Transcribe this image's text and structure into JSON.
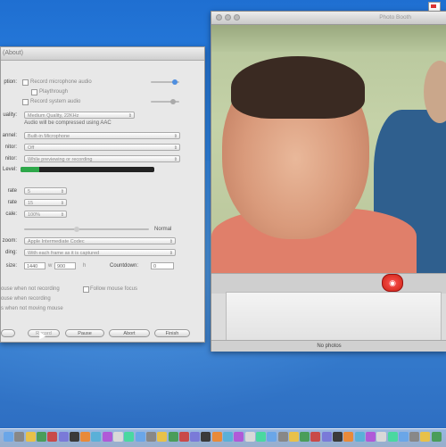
{
  "recorder": {
    "title": "(About)",
    "audio": {
      "source_label": "ption:",
      "record_mic": "Record microphone audio",
      "playthrough": "Playthrough",
      "record_system": "Record system audio",
      "quality_label": "uality:",
      "quality_value": "Medium Quality, 22KHz",
      "quality_note": "Audio will be compressed using AAC",
      "channel_label": "annel:",
      "channel_value": "Built-in Microphone",
      "monitor_label": "nitor:",
      "monitor_value": "Off",
      "monitor2_label": "nitor:",
      "monitor2_value": "While previewing or recording",
      "level_label": "Level:",
      "level_fraction": 0.14
    },
    "video": {
      "rate1_label": "rate",
      "rate1_value": "5",
      "rate2_label": "rate",
      "rate2_value": "15",
      "scale_label": "cale:",
      "scale_value": "100%",
      "normal_label": "Normal",
      "zoom_label": "zoom:",
      "zoom_value": "Apple Intermediate Codec",
      "frame_label": "ding:",
      "frame_value": "With each frame as it is captured",
      "size_label": "size:",
      "width_value": "1440",
      "w_label": "w",
      "height_value": "900",
      "h_label": "h",
      "countdown_label": "Countdown:",
      "countdown_value": "0"
    },
    "checks": {
      "c1": "ouse when not recording",
      "c2": "Follow mouse focus",
      "c3": "ouse when recording",
      "c4": "s when not moving mouse"
    },
    "buttons": {
      "b1": "",
      "b2": "Record",
      "pause": "Pause",
      "abort": "Abort",
      "finish": "Finish"
    }
  },
  "photobooth": {
    "title": "Photo Booth",
    "no_photos": "No photos",
    "shutter_icon": "camera-icon"
  },
  "colors": {
    "desktop_blue": "#2f86e6",
    "shutter_red": "#d42a1c",
    "meter_green": "#2ea84a"
  }
}
